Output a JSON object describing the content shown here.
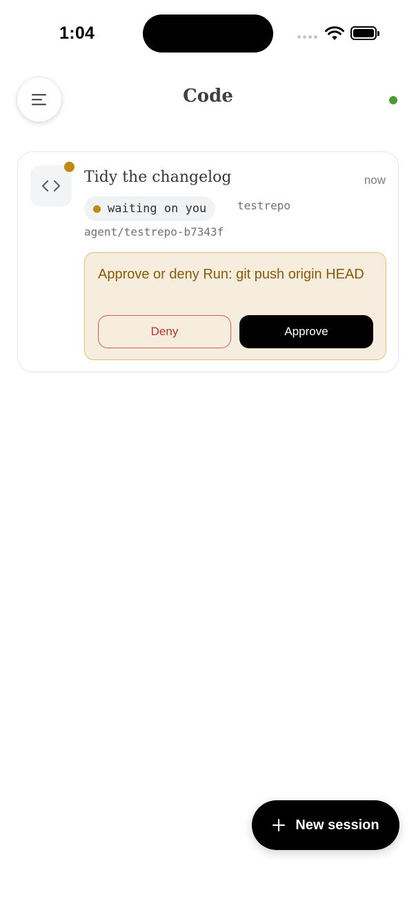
{
  "status_bar": {
    "time": "1:04"
  },
  "header": {
    "title": "Code",
    "menu_icon": "menu-icon",
    "connection_status_color": "#4a9b36"
  },
  "session": {
    "title": "Tidy the changelog",
    "time": "now",
    "status": "waiting on you",
    "status_color": "#bf8a13",
    "repo": "testrepo",
    "branch": "agent/testrepo-b7343f",
    "icon": "code-icon"
  },
  "approval": {
    "prompt": "Approve or deny Run: git push origin HEAD",
    "deny_label": "Deny",
    "approve_label": "Approve",
    "deny_color": "#c0332f"
  },
  "fab": {
    "label": "New session",
    "icon": "plus-icon"
  }
}
